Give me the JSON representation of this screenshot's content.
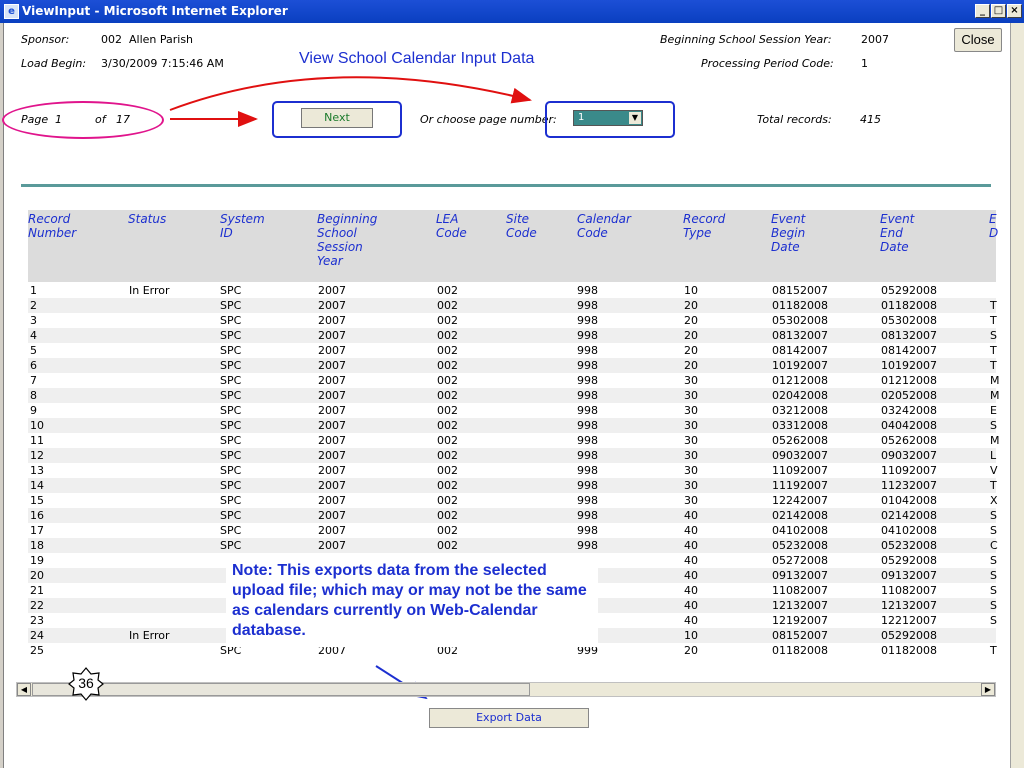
{
  "window": {
    "title": "ViewInput - Microsoft Internet Explorer",
    "minimize": "_",
    "maximize": "□",
    "close": "×"
  },
  "header": {
    "sponsor_label": "Sponsor:",
    "sponsor_value": "002  Allen Parish",
    "load_begin_label": "Load Begin:",
    "load_begin_value": "3/30/2009 7:15:46 AM",
    "heading": "View School Calendar Input Data",
    "session_year_label": "Beginning School Session Year:",
    "session_year_value": "2007",
    "processing_label": "Processing Period Code:",
    "processing_value": "1",
    "close_button": "Close"
  },
  "pager": {
    "page_label": "Page",
    "current_page": "1",
    "of_label": "of",
    "total_pages": "17",
    "next_button": "Next",
    "choose_label": "Or choose page number:",
    "selected_page": "1",
    "total_records_label": "Total records:",
    "total_records_value": "415"
  },
  "table": {
    "columns": [
      "Record\nNumber",
      "Status",
      "System\nID",
      "Beginning\nSchool\nSession\nYear",
      "LEA\nCode",
      "Site\nCode",
      "Calendar\nCode",
      "Record\nType",
      "Event\nBegin\nDate",
      "Event\nEnd\nDate",
      "E\nD"
    ],
    "rows": [
      [
        "1",
        "In Error",
        "SPC",
        "2007",
        "002",
        "",
        "998",
        "10",
        "08152007",
        "05292008",
        ""
      ],
      [
        "2",
        "",
        "SPC",
        "2007",
        "002",
        "",
        "998",
        "20",
        "01182008",
        "01182008",
        "T"
      ],
      [
        "3",
        "",
        "SPC",
        "2007",
        "002",
        "",
        "998",
        "20",
        "05302008",
        "05302008",
        "T"
      ],
      [
        "4",
        "",
        "SPC",
        "2007",
        "002",
        "",
        "998",
        "20",
        "08132007",
        "08132007",
        "S"
      ],
      [
        "5",
        "",
        "SPC",
        "2007",
        "002",
        "",
        "998",
        "20",
        "08142007",
        "08142007",
        "T"
      ],
      [
        "6",
        "",
        "SPC",
        "2007",
        "002",
        "",
        "998",
        "20",
        "10192007",
        "10192007",
        "T"
      ],
      [
        "7",
        "",
        "SPC",
        "2007",
        "002",
        "",
        "998",
        "30",
        "01212008",
        "01212008",
        "M"
      ],
      [
        "8",
        "",
        "SPC",
        "2007",
        "002",
        "",
        "998",
        "30",
        "02042008",
        "02052008",
        "M"
      ],
      [
        "9",
        "",
        "SPC",
        "2007",
        "002",
        "",
        "998",
        "30",
        "03212008",
        "03242008",
        "E"
      ],
      [
        "10",
        "",
        "SPC",
        "2007",
        "002",
        "",
        "998",
        "30",
        "03312008",
        "04042008",
        "S"
      ],
      [
        "11",
        "",
        "SPC",
        "2007",
        "002",
        "",
        "998",
        "30",
        "05262008",
        "05262008",
        "M"
      ],
      [
        "12",
        "",
        "SPC",
        "2007",
        "002",
        "",
        "998",
        "30",
        "09032007",
        "09032007",
        "L"
      ],
      [
        "13",
        "",
        "SPC",
        "2007",
        "002",
        "",
        "998",
        "30",
        "11092007",
        "11092007",
        "V"
      ],
      [
        "14",
        "",
        "SPC",
        "2007",
        "002",
        "",
        "998",
        "30",
        "11192007",
        "11232007",
        "T"
      ],
      [
        "15",
        "",
        "SPC",
        "2007",
        "002",
        "",
        "998",
        "30",
        "12242007",
        "01042008",
        "X"
      ],
      [
        "16",
        "",
        "SPC",
        "2007",
        "002",
        "",
        "998",
        "40",
        "02142008",
        "02142008",
        "S"
      ],
      [
        "17",
        "",
        "SPC",
        "2007",
        "002",
        "",
        "998",
        "40",
        "04102008",
        "04102008",
        "S"
      ],
      [
        "18",
        "",
        "SPC",
        "2007",
        "002",
        "",
        "998",
        "40",
        "05232008",
        "05232008",
        "C"
      ],
      [
        "19",
        "",
        "",
        "",
        "",
        "",
        "",
        "40",
        "05272008",
        "05292008",
        "S"
      ],
      [
        "20",
        "",
        "",
        "",
        "",
        "",
        "",
        "40",
        "09132007",
        "09132007",
        "S"
      ],
      [
        "21",
        "",
        "",
        "",
        "",
        "",
        "",
        "40",
        "11082007",
        "11082007",
        "S"
      ],
      [
        "22",
        "",
        "",
        "",
        "",
        "",
        "",
        "40",
        "12132007",
        "12132007",
        "S"
      ],
      [
        "23",
        "",
        "",
        "",
        "",
        "",
        "",
        "40",
        "12192007",
        "12212007",
        "S"
      ],
      [
        "24",
        "In Error",
        "",
        "",
        "",
        "",
        "",
        "10",
        "08152007",
        "05292008",
        ""
      ],
      [
        "25",
        "",
        "SPC",
        "2007",
        "002",
        "",
        "999",
        "20",
        "01182008",
        "01182008",
        "T"
      ]
    ]
  },
  "note": "Note:  This exports data from the selected upload file; which may or may not be the same as calendars currently on Web-Calendar database.",
  "badge": "36",
  "export_button": "Export Data",
  "colors": {
    "titlebar": "#0a3fc0",
    "heading_blue": "#1c2fd0",
    "annotation_pink": "#e0148c",
    "annotation_red": "#e01010",
    "divider_teal": "#5a9a9a",
    "select_teal": "#3a8a8a"
  }
}
